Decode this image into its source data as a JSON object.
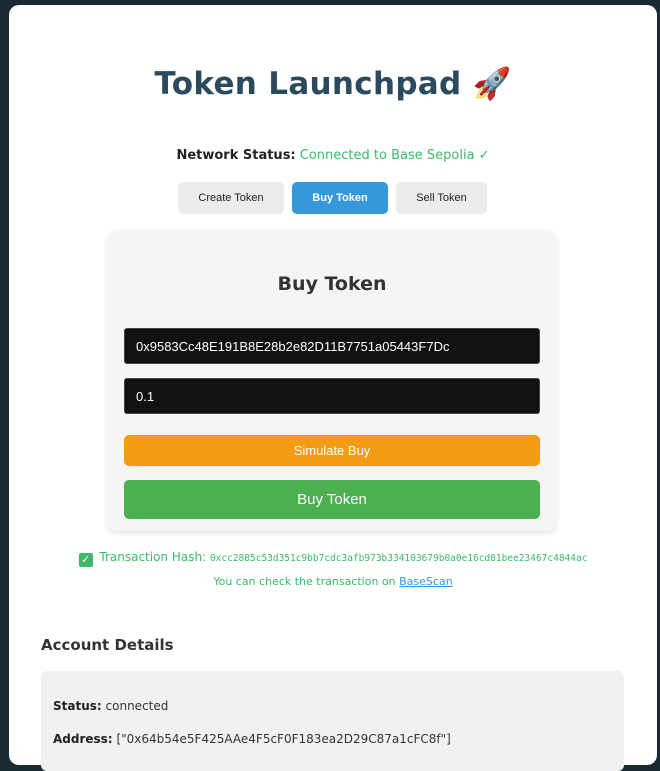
{
  "header": {
    "title": "Token Launchpad",
    "title_emoji": "🚀"
  },
  "network": {
    "label": "Network Status:",
    "value": "Connected to Base Sepolia ✓"
  },
  "tabs": [
    {
      "label": "Create Token",
      "active": false
    },
    {
      "label": "Buy Token",
      "active": true
    },
    {
      "label": "Sell Token",
      "active": false
    }
  ],
  "buy_panel": {
    "title": "Buy Token",
    "token_address_value": "0x9583Cc48E191B8E28b2e82D11B7751a05443F7Dc",
    "amount_value": "0.1",
    "simulate_label": "Simulate Buy",
    "buy_label": "Buy Token"
  },
  "transaction": {
    "label": "Transaction Hash:",
    "hash": "0xcc2885c53d351c9bb7cdc3afb973b334103679b0a0e16cd81bee23467c4844ac",
    "check_text": "You can check the transaction on",
    "link_text": "BaseScan"
  },
  "account": {
    "title": "Account Details",
    "status_label": "Status:",
    "status_value": "connected",
    "address_label": "Address:",
    "address_value": "[\"0x64b54e5F425AAe4F5cF0F183ea2D29C87a1cFC8f\"]"
  },
  "colors": {
    "background": "#1b2b33",
    "title": "#2c4a5e",
    "success": "#3cb868",
    "tab_active": "#3498db",
    "simulate_button": "#f39c12",
    "buy_button": "#4caf50"
  }
}
